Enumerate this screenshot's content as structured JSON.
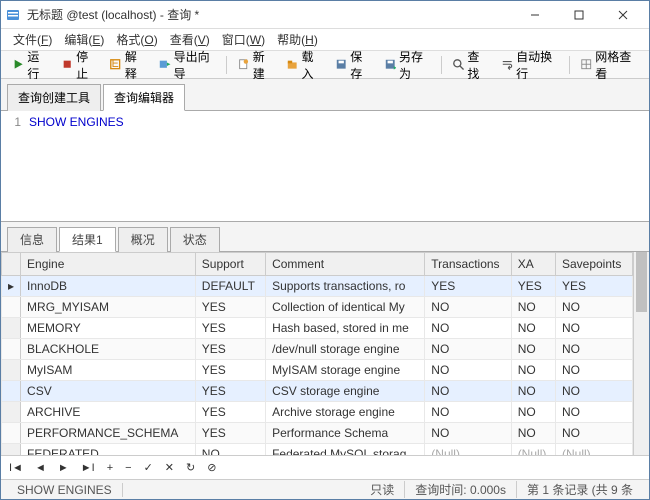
{
  "window": {
    "title": "无标题 @test (localhost) - 查询 *"
  },
  "menu": {
    "file": "文件",
    "file_k": "F",
    "edit": "编辑",
    "edit_k": "E",
    "format": "格式",
    "format_k": "O",
    "view": "查看",
    "view_k": "V",
    "window": "窗口",
    "window_k": "W",
    "help": "帮助",
    "help_k": "H"
  },
  "toolbar": {
    "run": "运行",
    "stop": "停止",
    "explain": "解释",
    "export": "导出向导",
    "new": "新建",
    "load": "载入",
    "save": "保存",
    "saveas": "另存为",
    "find": "查找",
    "autowrap": "自动换行",
    "gridview": "网格查看"
  },
  "editor_tabs": {
    "builder": "查询创建工具",
    "editor": "查询编辑器"
  },
  "editor": {
    "line_no": "1",
    "sql": "SHOW ENGINES"
  },
  "result_tabs": {
    "info": "信息",
    "result": "结果1",
    "profile": "概况",
    "status": "状态"
  },
  "grid": {
    "columns": [
      "Engine",
      "Support",
      "Comment",
      "Transactions",
      "XA",
      "Savepoints"
    ],
    "rows": [
      {
        "sel": true,
        "cells": [
          "InnoDB",
          "DEFAULT",
          "Supports transactions, ro",
          "YES",
          "YES",
          "YES"
        ]
      },
      {
        "sel": false,
        "cells": [
          "MRG_MYISAM",
          "YES",
          "Collection of identical My",
          "NO",
          "NO",
          "NO"
        ]
      },
      {
        "sel": false,
        "cells": [
          "MEMORY",
          "YES",
          "Hash based, stored in me",
          "NO",
          "NO",
          "NO"
        ]
      },
      {
        "sel": false,
        "cells": [
          "BLACKHOLE",
          "YES",
          "/dev/null storage engine",
          "NO",
          "NO",
          "NO"
        ]
      },
      {
        "sel": false,
        "cells": [
          "MyISAM",
          "YES",
          "MyISAM storage engine",
          "NO",
          "NO",
          "NO"
        ]
      },
      {
        "sel": true,
        "cells": [
          "CSV",
          "YES",
          "CSV storage engine",
          "NO",
          "NO",
          "NO"
        ]
      },
      {
        "sel": false,
        "cells": [
          "ARCHIVE",
          "YES",
          "Archive storage engine",
          "NO",
          "NO",
          "NO"
        ]
      },
      {
        "sel": false,
        "cells": [
          "PERFORMANCE_SCHEMA",
          "YES",
          "Performance Schema",
          "NO",
          "NO",
          "NO"
        ]
      },
      {
        "sel": false,
        "cells": [
          "FEDERATED",
          "NO",
          "Federated MySQL storag",
          null,
          null,
          null
        ]
      }
    ],
    "null_text": "(Null)"
  },
  "status": {
    "query": "SHOW ENGINES",
    "readonly": "只读",
    "time_label": "查询时间:",
    "time": "0.000s",
    "record": "第 1 条记录 (共 9 条"
  }
}
